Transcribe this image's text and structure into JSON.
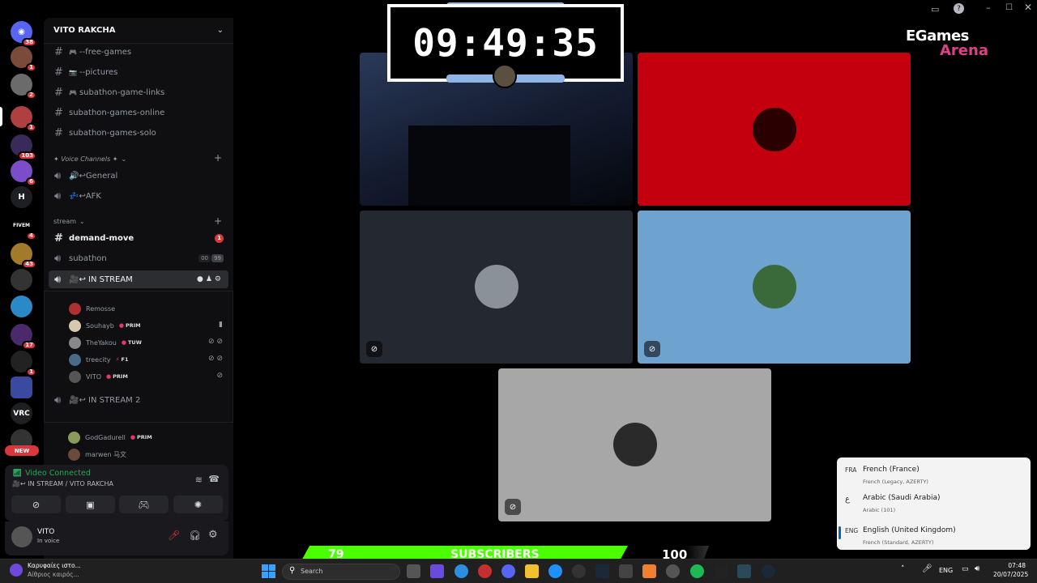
{
  "server_rail": {
    "items": [
      {
        "icon": "discord-logo-icon",
        "badge": "38",
        "color": "#5865f2"
      },
      {
        "icon": "server-avatar-icon",
        "badge": "1",
        "color": "#7a4a3a"
      },
      {
        "icon": "server-avatar-icon",
        "badge": "2",
        "color": "#6b6b6b"
      },
      {
        "icon": "server-avatar-icon",
        "badge": "1",
        "color": "#b04040"
      },
      {
        "icon": "server-avatar-icon",
        "badge": "103",
        "color": "#3a2a5a"
      },
      {
        "icon": "server-avatar-icon",
        "badge": "6",
        "color": "#7b4dc9"
      },
      {
        "label": "H",
        "color": "#1e1f22"
      },
      {
        "label": "FIVEM",
        "badge": "4",
        "color": "#000"
      },
      {
        "icon": "server-avatar-icon",
        "badge": "43",
        "color": "#a37a2a"
      },
      {
        "icon": "server-avatar-icon",
        "color": "#333"
      },
      {
        "icon": "server-avatar-icon",
        "color": "#2a8ac7"
      },
      {
        "icon": "server-avatar-icon",
        "badge": "17",
        "color": "#4a2a6a"
      },
      {
        "icon": "server-avatar-icon",
        "badge": "1",
        "color": "#222"
      },
      {
        "icon": "server-avatar-icon",
        "color": "#3a4aa0"
      },
      {
        "label": "VRC",
        "color": "#1e1f22"
      },
      {
        "icon": "server-avatar-icon",
        "color": "#333"
      }
    ],
    "new_badge": "NEW"
  },
  "server": {
    "name": "VITO RAKCHA"
  },
  "channels_top": [
    {
      "emoji": "🎮",
      "name": "--free-games"
    },
    {
      "emoji": "📷",
      "name": "--pictures"
    },
    {
      "emoji": "🎮",
      "name": "subathon-game-links"
    },
    {
      "name": "subathon-games-online"
    },
    {
      "name": "subathon-games-solo"
    }
  ],
  "voice_category": "✦ Voice Channels ✦",
  "voice_channels": [
    {
      "name": "🔊↩General"
    },
    {
      "name": "💤↩AFK"
    }
  ],
  "stream_category": "stream",
  "stream_channels": {
    "demand_move": "demand-move",
    "demand_move_badge": "1",
    "subathon": "subathon",
    "subathon_count_a": "00",
    "subathon_count_b": "99",
    "in_stream": "🎥↩ IN STREAM",
    "in_stream_2": "🎥↩ IN STREAM 2"
  },
  "voice_users": [
    {
      "name": "Remosse",
      "tag": "",
      "color": "#b03030"
    },
    {
      "name": "Souhayb",
      "tag": "PRIM",
      "color": "#d8c8b0"
    },
    {
      "name": "TheYakou",
      "tag": "TUW",
      "color": "#888"
    },
    {
      "name": "treecity",
      "tag": "F1",
      "color": "#4a6a8a"
    },
    {
      "name": "VITO",
      "tag": "PRIM",
      "color": "#555"
    }
  ],
  "voice_users_2": [
    {
      "name": "GodGadurell",
      "tag": "PRIM",
      "color": "#8a9a5a"
    },
    {
      "name": "marwen 马文",
      "tag": "",
      "color": "#6a4a3a"
    }
  ],
  "voice_status": {
    "title": "Video Connected",
    "subtitle": "🎥↩ IN STREAM / VITO RAKCHA"
  },
  "user": {
    "name": "VITO",
    "status": "In voice"
  },
  "timer": "09:49:35",
  "brand": {
    "line1": "EGames",
    "line2": "Arena"
  },
  "tiles": [
    {
      "color": "#0c0e18"
    },
    {
      "color": "#c4000f"
    },
    {
      "color": "#242830"
    },
    {
      "color": "#6fa3cf"
    },
    {
      "color": "#a7a7a7"
    }
  ],
  "subscribers": {
    "current": "79",
    "label": "SUBSCRIBERS",
    "goal": "100",
    "progress": 0.79
  },
  "language_menu": [
    {
      "code": "FRA",
      "name": "French (France)",
      "sub": "French (Legacy, AZERTY)"
    },
    {
      "code": "ع",
      "name": "Arabic (Saudi Arabia)",
      "sub": "Arabic (101)"
    },
    {
      "code": "ENG",
      "name": "English (United Kingdom)",
      "sub": "French (Standard, AZERTY)",
      "selected": true
    }
  ],
  "taskbar": {
    "weather_title": "Καρυφαίες ιστο...",
    "weather_sub": "Αίθριος καιρός...",
    "search_placeholder": "Search",
    "lang": "ENG",
    "time": "07:48",
    "date": "20/07/2025"
  }
}
